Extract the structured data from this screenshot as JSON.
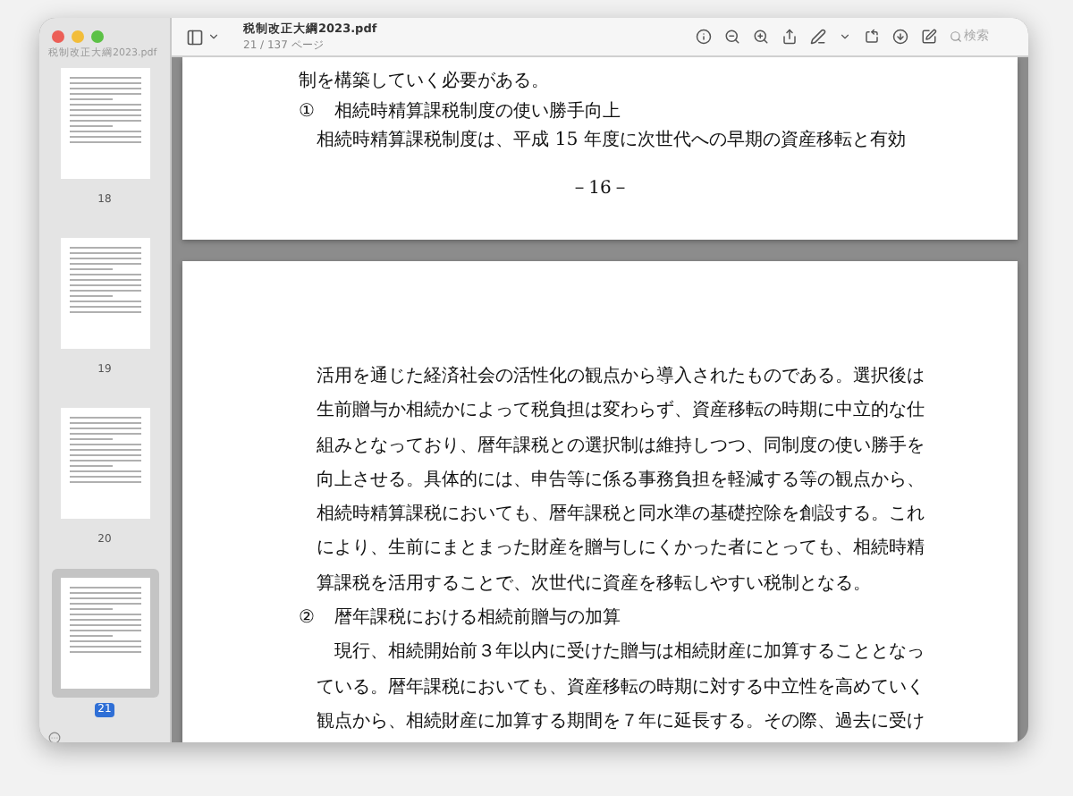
{
  "window": {
    "title": "税制改正大綱2023.pdf",
    "subtitle": "21 / 137 ページ"
  },
  "search": {
    "placeholder": "検索"
  },
  "sidebar": {
    "title": "税制改正大綱2023.pdf",
    "thumbnails": [
      {
        "label": "18",
        "selected": false
      },
      {
        "label": "19",
        "selected": false
      },
      {
        "label": "20",
        "selected": false
      },
      {
        "label": "21",
        "selected": true
      }
    ]
  },
  "pages": [
    {
      "lines": [
        {
          "kind": "body",
          "text": "制を構築していく必要がある。"
        },
        {
          "kind": "heading",
          "number": "①",
          "text": "相続時精算課税制度の使い勝手向上"
        },
        {
          "kind": "indent",
          "text": "相続時精算課税制度は、平成 15 年度に次世代への早期の資産移転と有効"
        }
      ],
      "page_number": "－16－"
    },
    {
      "lines": [
        {
          "kind": "indent",
          "text": "活用を通じた経済社会の活性化の観点から導入されたものである。選択後は"
        },
        {
          "kind": "indent",
          "text": "生前贈与か相続かによって税負担は変わらず、資産移転の時期に中立的な仕"
        },
        {
          "kind": "indent",
          "text": "組みとなっており、暦年課税との選択制は維持しつつ、同制度の使い勝手を"
        },
        {
          "kind": "indent",
          "text": "向上させる。具体的には、申告等に係る事務負担を軽減する等の観点から、"
        },
        {
          "kind": "indent",
          "text": "相続時精算課税においても、暦年課税と同水準の基礎控除を創設する。これ"
        },
        {
          "kind": "indent",
          "text": "により、生前にまとまった財産を贈与しにくかった者にとっても、相続時精"
        },
        {
          "kind": "indent",
          "text": "算課税を活用することで、次世代に資産を移転しやすい税制となる。"
        },
        {
          "kind": "heading",
          "number": "②",
          "text": "暦年課税における相続前贈与の加算"
        },
        {
          "kind": "indent",
          "text": "　現行、相続開始前３年以内に受けた贈与は相続財産に加算することとなっ"
        },
        {
          "kind": "indent",
          "text": "ている。暦年課税においても、資産移転の時期に対する中立性を高めていく"
        },
        {
          "kind": "indent",
          "text": "観点から、相続財産に加算する期間を７年に延長する。その際、過去に受け"
        }
      ]
    }
  ]
}
